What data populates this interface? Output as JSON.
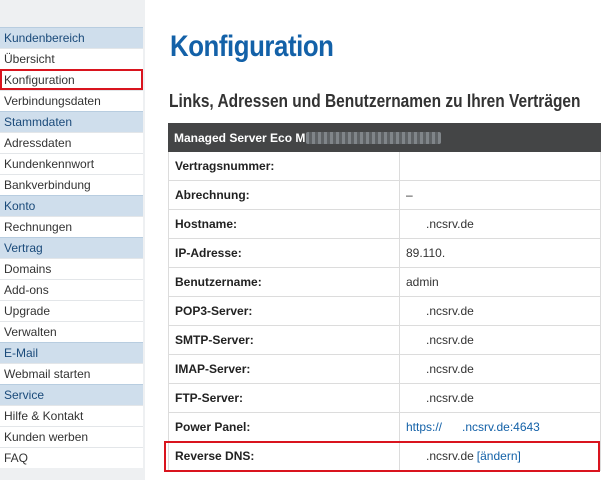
{
  "sidebar": [
    {
      "type": "head",
      "label": "Kundenbereich"
    },
    {
      "type": "link",
      "label": "Übersicht"
    },
    {
      "type": "link",
      "label": "Konfiguration",
      "active": true
    },
    {
      "type": "link",
      "label": "Verbindungsdaten"
    },
    {
      "type": "head",
      "label": "Stammdaten"
    },
    {
      "type": "link",
      "label": "Adressdaten"
    },
    {
      "type": "link",
      "label": "Kundenkennwort"
    },
    {
      "type": "link",
      "label": "Bankverbindung"
    },
    {
      "type": "head",
      "label": "Konto"
    },
    {
      "type": "link",
      "label": "Rechnungen"
    },
    {
      "type": "head",
      "label": "Vertrag"
    },
    {
      "type": "link",
      "label": "Domains"
    },
    {
      "type": "link",
      "label": "Add-ons"
    },
    {
      "type": "link",
      "label": "Upgrade"
    },
    {
      "type": "link",
      "label": "Verwalten"
    },
    {
      "type": "head",
      "label": "E-Mail"
    },
    {
      "type": "link",
      "label": "Webmail starten"
    },
    {
      "type": "head",
      "label": "Service"
    },
    {
      "type": "link",
      "label": "Hilfe & Kontakt"
    },
    {
      "type": "link",
      "label": "Kunden werben"
    },
    {
      "type": "link",
      "label": "FAQ"
    }
  ],
  "main": {
    "title": "Konfiguration",
    "subtitle": "Links, Adressen und Benutzernamen zu Ihren Verträgen",
    "table": {
      "header": "Managed Server Eco M",
      "rows": [
        {
          "label": "Vertragsnummer:",
          "value": ""
        },
        {
          "label": "Abrechnung:",
          "value": "–"
        },
        {
          "label": "Hostname:",
          "value": ".ncsrv.de",
          "indent": true
        },
        {
          "label": "IP-Adresse:",
          "value": "89.110."
        },
        {
          "label": "Benutzername:",
          "value": "admin"
        },
        {
          "label": "POP3-Server:",
          "value": ".ncsrv.de",
          "indent": true
        },
        {
          "label": "SMTP-Server:",
          "value": ".ncsrv.de",
          "indent": true
        },
        {
          "label": "IMAP-Server:",
          "value": ".ncsrv.de",
          "indent": true
        },
        {
          "label": "FTP-Server:",
          "value": ".ncsrv.de",
          "indent": true
        },
        {
          "label": "Power Panel:",
          "value": "https://",
          "value2": ".ncsrv.de:4643",
          "link": true
        },
        {
          "label": "Reverse DNS:",
          "value": ".ncsrv.de",
          "indent": true,
          "action": "[ändern]"
        }
      ]
    }
  },
  "colors": {
    "accent": "#1361a8",
    "highlight": "#d9141e",
    "sidebar_head": "#cfdeec"
  }
}
